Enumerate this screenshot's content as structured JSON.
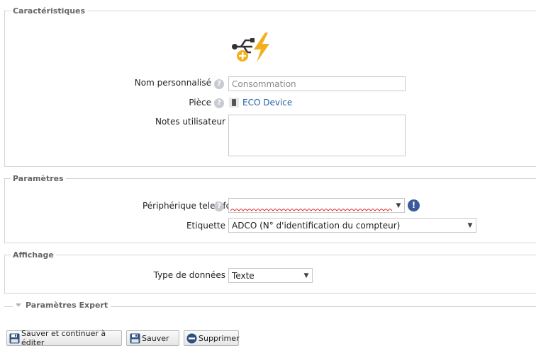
{
  "caracteristiques": {
    "legend": "Caractéristiques",
    "nom_label": "Nom personnalisé",
    "nom_placeholder": "Consommation",
    "piece_label": "Pièce",
    "piece_value": "ECO Device",
    "notes_label": "Notes utilisateur",
    "notes_value": ""
  },
  "parametres": {
    "legend": "Paramètres",
    "periph_label": "Périphérique teleinfo",
    "periph_value": "",
    "etiquette_label": "Etiquette",
    "etiquette_value": "ADCO (N° d'identification du compteur)"
  },
  "affichage": {
    "legend": "Affichage",
    "type_label": "Type de données",
    "type_value": "Texte"
  },
  "expert": {
    "legend": "Paramètres Expert"
  },
  "buttons": {
    "save_continue": "Sauver et continuer à éditer",
    "save": "Sauver",
    "delete": "Supprimer"
  },
  "icons": {
    "help": "question-mark-icon",
    "warning": "exclamation-icon",
    "device": "usb-lightning-icon",
    "room": "room-icon",
    "save": "floppy-disk-icon",
    "delete": "minus-circle-icon"
  },
  "colors": {
    "link": "#1f5fa8",
    "warning": "#3a5a9c",
    "accent": "#f2b01e"
  }
}
